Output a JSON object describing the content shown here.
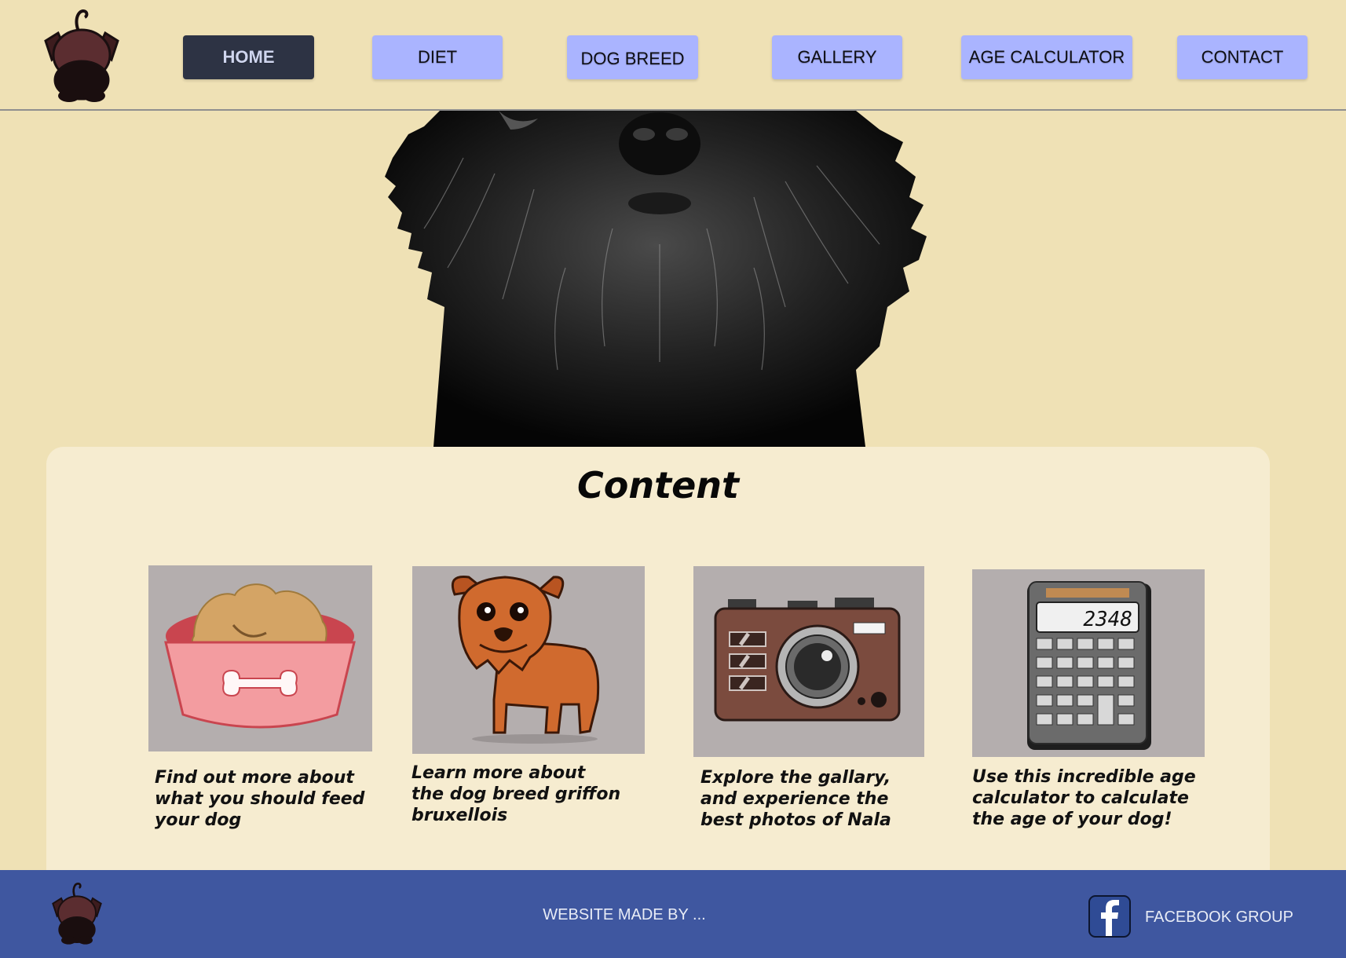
{
  "colors": {
    "page_bg": "#efe1b5",
    "panel_bg": "#f6ecd0",
    "nav_button": "#aab4ff",
    "nav_button_active": "#2d3344",
    "footer_bg": "#3f57a0",
    "card_bg": "#b4aeae"
  },
  "nav": {
    "items": [
      {
        "label": "HOME",
        "active": true
      },
      {
        "label": "DIET",
        "active": false
      },
      {
        "label": "DOG BREED",
        "active": false
      },
      {
        "label": "GALLERY",
        "active": false
      },
      {
        "label": "AGE CALCULATOR",
        "active": false
      },
      {
        "label": "CONTACT",
        "active": false
      }
    ]
  },
  "hero": {
    "icon": "dog-portrait-photo"
  },
  "content": {
    "title": "Content",
    "cards": [
      {
        "icon": "dog-bowl-icon",
        "text": "Find out more about what you should feed your dog"
      },
      {
        "icon": "dog-breed-icon",
        "text": "Learn more about the dog breed griffon bruxellois"
      },
      {
        "icon": "camera-icon",
        "text": "Explore the gallary, and experience the best photos of Nala"
      },
      {
        "icon": "calculator-icon",
        "text": "Use this incredible age calculator to calculate the age of your dog!",
        "display": "2348"
      }
    ]
  },
  "footer": {
    "credit": "WEBSITE MADE BY ...",
    "facebook_label": "FACEBOOK GROUP"
  }
}
